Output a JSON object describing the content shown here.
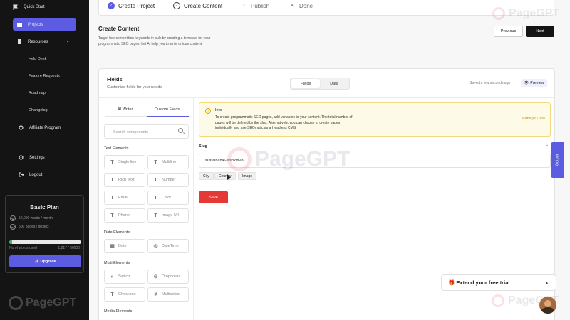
{
  "sidebar": {
    "quick_start": "Quick Start",
    "projects": "Projects",
    "resources": "Resources",
    "resources_items": [
      "Help Desk",
      "Feature Requests",
      "Roadmap",
      "Changelog"
    ],
    "affiliate": "Affiliate Program",
    "settings": "Settings",
    "logout": "Logout",
    "plan": {
      "title": "Basic Plan",
      "features": [
        "50,000 words / month",
        "500 pages / project"
      ],
      "words_label": "No of words used",
      "words_count": "1,817 / 50000",
      "progress_fraction": 0.036,
      "upgrade": "✨ Upgrade"
    },
    "watermark": "PageGPT"
  },
  "stepper": {
    "steps": [
      {
        "num": "✓",
        "label": "Create Project"
      },
      {
        "num": "2",
        "label": "Create Content"
      },
      {
        "num": "3",
        "label": "Publish"
      },
      {
        "num": "4",
        "label": "Done"
      }
    ]
  },
  "header": {
    "title": "Create Content",
    "description": "Target low-competition keywords in bulk by creating a template for your programmatic SEO pages.  Let AI help you to write unique content.",
    "prev": "Previous",
    "next": "Next"
  },
  "card": {
    "title": "Fields",
    "subtitle": "Customize fields for your needs",
    "toggle": [
      "Fields",
      "Data"
    ],
    "saved": "Saved a few seconds ago",
    "preview": "Preview",
    "tabs": [
      "AI Writer",
      "Custom Fields"
    ],
    "search_placeholder": "Search components",
    "text_elements_label": "Text Elements",
    "text_elements": [
      {
        "icon": "T",
        "label": "Single line"
      },
      {
        "icon": "T",
        "label": "Multiline"
      },
      {
        "icon": "T",
        "label": "Rich Text"
      },
      {
        "icon": "T",
        "label": "Number"
      },
      {
        "icon": "T",
        "label": "Email"
      },
      {
        "icon": "T",
        "label": "Color"
      },
      {
        "icon": "T",
        "label": "Phone"
      },
      {
        "icon": "T",
        "label": "Image Url"
      }
    ],
    "date_elements_label": "Date Elements",
    "date_elements": [
      {
        "icon": "▦",
        "label": "Date"
      },
      {
        "icon": "◷",
        "label": "DateTime"
      }
    ],
    "multi_elements_label": "Multi Elements",
    "multi_elements": [
      {
        "icon": "◐",
        "label": "Switch"
      },
      {
        "icon": "⊖",
        "label": "Dropdown"
      },
      {
        "icon": "T",
        "label": "Checkbox"
      },
      {
        "icon": "#",
        "label": "Multiselect"
      }
    ],
    "media_elements_label": "Media Elements",
    "info": {
      "title": "Info",
      "text": "To create programmatic SEO pages, add variables to your content. The total number of pages will be defined by the slug. Alternatively, you can choose to create pages individually and use SEOmatic as a Headless CMS.",
      "manage": "Manage Data"
    },
    "slug_label": "Slug",
    "slug_value": "sustainable-fashion-in-",
    "chips": [
      "City",
      "Country",
      "Image"
    ],
    "save": "Save"
  },
  "output_tab": "Output",
  "trial": "🎁 Extend your free trial",
  "watermark": "PageGPT",
  "colors": {
    "accent": "#5b5ce2",
    "danger": "#e53935",
    "sidebar": "#141414"
  }
}
